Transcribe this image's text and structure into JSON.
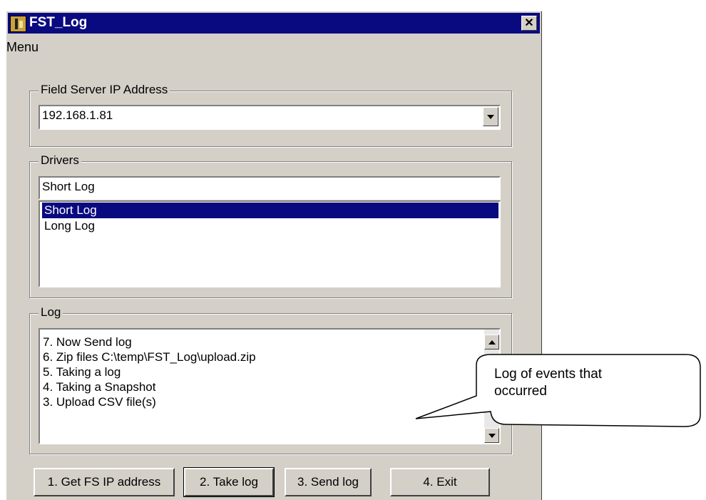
{
  "window": {
    "title": "FST_Log",
    "close_glyph": "✕"
  },
  "menu": {
    "label": "Menu"
  },
  "ip_group": {
    "legend": "Field Server IP Address",
    "value": "192.168.1.81"
  },
  "drivers_group": {
    "legend": "Drivers",
    "text_value": "Short Log",
    "items": [
      {
        "label": "Short Log",
        "selected": true
      },
      {
        "label": "Long Log",
        "selected": false
      }
    ]
  },
  "log_group": {
    "legend": "Log",
    "lines": [
      "7. Now Send log",
      "6. Zip files C:\\temp\\FST_Log\\upload.zip",
      "5. Taking a log",
      "4. Taking a Snapshot",
      "3. Upload CSV file(s)"
    ]
  },
  "buttons": {
    "get_ip": "1. Get FS IP address",
    "take_log": "2. Take log",
    "send_log": "3. Send log",
    "exit": "4. Exit"
  },
  "callout": {
    "line1": "Log of events that",
    "line2": "occurred"
  },
  "colors": {
    "titlebar": "#0a0a80",
    "selection": "#0a0a80",
    "face": "#d4d0c8"
  }
}
